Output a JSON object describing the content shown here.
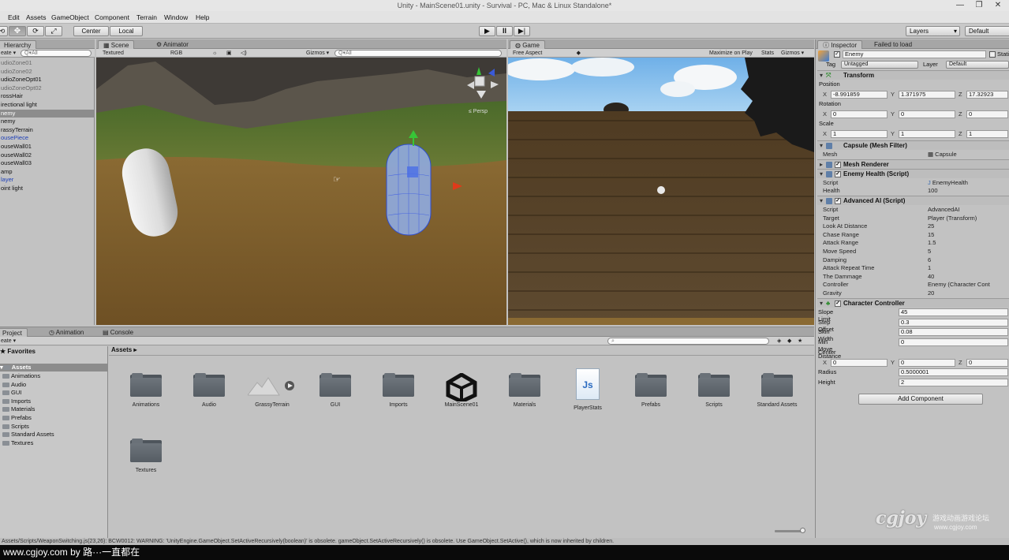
{
  "window": {
    "title": "Unity - MainScene01.unity - Survival - PC, Mac & Linux Standalone*",
    "controls": [
      "—",
      "❐",
      "✕"
    ]
  },
  "menu": [
    "Edit",
    "Assets",
    "GameObject",
    "Component",
    "Terrain",
    "Window",
    "Help"
  ],
  "toolbar": {
    "pivot": "Center",
    "space": "Local",
    "layers": "Layers",
    "layout": "Default"
  },
  "hierarchy": {
    "tab": "Hierarchy",
    "create": "eate ▾",
    "search_placeholder": "Q▾All",
    "items": [
      {
        "label": "udioZone01",
        "style": "grey"
      },
      {
        "label": "udioZone02",
        "style": "grey"
      },
      {
        "label": "udioZoneOpt01",
        "style": "normal"
      },
      {
        "label": "udioZoneOpt02",
        "style": "grey"
      },
      {
        "label": "rossHair",
        "style": "normal"
      },
      {
        "label": "irectional light",
        "style": "normal"
      },
      {
        "label": "nemy",
        "style": "selected"
      },
      {
        "label": "nemy",
        "style": "normal"
      },
      {
        "label": "rassyTerrain",
        "style": "normal"
      },
      {
        "label": "ousePiece",
        "style": "blue"
      },
      {
        "label": "ouseWall01",
        "style": "normal"
      },
      {
        "label": "ouseWall02",
        "style": "normal"
      },
      {
        "label": "ouseWall03",
        "style": "normal"
      },
      {
        "label": "amp",
        "style": "normal"
      },
      {
        "label": "layer",
        "style": "blue"
      },
      {
        "label": "oint light",
        "style": "normal"
      }
    ]
  },
  "scene": {
    "tab_scene": "Scene",
    "tab_animator": "Animator",
    "shading": "Textured",
    "render": "RGB",
    "gizmos": "Gizmos ▾",
    "search_placeholder": "Q▾All",
    "persp": "≤ Persp"
  },
  "game": {
    "tab": "Game",
    "aspect": "Free Aspect",
    "maximize": "Maximize on Play",
    "stats": "Stats",
    "gizmos": "Gizmos ▾"
  },
  "inspector": {
    "tab": "Inspector",
    "tab2": "Failed to load",
    "object_name": "Enemy",
    "static_label": "Static",
    "tag_label": "Tag",
    "tag_value": "Untagged",
    "layer_label": "Layer",
    "layer_value": "Default",
    "transform": {
      "title": "Transform",
      "position_label": "Position",
      "position": {
        "x": "-8.991859",
        "y": "1.371975",
        "z": "17.32923"
      },
      "rotation_label": "Rotation",
      "rotation": {
        "x": "0",
        "y": "0",
        "z": "0"
      },
      "scale_label": "Scale",
      "scale": {
        "x": "1",
        "y": "1",
        "z": "1"
      }
    },
    "mesh_filter": {
      "title": "Capsule (Mesh Filter)",
      "mesh_label": "Mesh",
      "mesh_value": "Capsule"
    },
    "mesh_renderer": {
      "title": "Mesh Renderer"
    },
    "enemy_health": {
      "title": "Enemy Health (Script)",
      "script_label": "Script",
      "script_value": "EnemyHealth",
      "health_label": "Health",
      "health_value": "100"
    },
    "advanced_ai": {
      "title": "Advanced AI (Script)",
      "rows": [
        {
          "label": "Script",
          "value": "AdvancedAI"
        },
        {
          "label": "Target",
          "value": "Player (Transform)"
        },
        {
          "label": "Look At Distance",
          "value": "25"
        },
        {
          "label": "Chase Range",
          "value": "15"
        },
        {
          "label": "Attack Range",
          "value": "1.5"
        },
        {
          "label": "Move Speed",
          "value": "5"
        },
        {
          "label": "Damping",
          "value": "6"
        },
        {
          "label": "Attack Repeat Time",
          "value": "1"
        },
        {
          "label": "The Dammage",
          "value": "40"
        },
        {
          "label": "Controller",
          "value": "Enemy (Character Cont"
        },
        {
          "label": "Gravity",
          "value": "20"
        }
      ]
    },
    "character_controller": {
      "title": "Character Controller",
      "rows": [
        {
          "label": "Slope Limit",
          "value": "45"
        },
        {
          "label": "Step Offset",
          "value": "0.3"
        },
        {
          "label": "Skin Width",
          "value": "0.08"
        },
        {
          "label": "Min Move Distance",
          "value": "0"
        }
      ],
      "center_label": "Center",
      "center": {
        "x": "0",
        "y": "0",
        "z": "0"
      },
      "radius_label": "Radius",
      "radius_value": "0.5000001",
      "height_label": "Height",
      "height_value": "2"
    },
    "add_component": "Add Component"
  },
  "project": {
    "tab_project": "Project",
    "tab_animation": "Animation",
    "tab_console": "Console",
    "create": "eate ▾",
    "favorites": "Favorites",
    "assets_root": "Assets",
    "tree": [
      "Animations",
      "Audio",
      "GUI",
      "Imports",
      "Materials",
      "Prefabs",
      "Scripts",
      "Standard Assets",
      "Textures"
    ],
    "breadcrumb": "Assets ▸",
    "assets": [
      {
        "label": "Animations",
        "kind": "folder"
      },
      {
        "label": "Audio",
        "kind": "folder"
      },
      {
        "label": "GrassyTerrain",
        "kind": "terrain"
      },
      {
        "label": "GUI",
        "kind": "folder"
      },
      {
        "label": "Imports",
        "kind": "folder"
      },
      {
        "label": "MainScene01",
        "kind": "unity"
      },
      {
        "label": "Materials",
        "kind": "folder"
      },
      {
        "label": "PlayerStats",
        "kind": "js"
      },
      {
        "label": "Prefabs",
        "kind": "folder"
      },
      {
        "label": "Scripts",
        "kind": "folder"
      },
      {
        "label": "Standard Assets",
        "kind": "folder"
      },
      {
        "label": "Textures",
        "kind": "folder"
      }
    ]
  },
  "status": {
    "message": "Assets/Scripts/WeaponSwitching.js(23,26): BCW0012: WARNING: 'UnityEngine.GameObject.SetActiveRecursively(boolean)' is obsolete. gameObject.SetActiveRecursively() is obsolete. Use GameObject.SetActive(), which is now inherited by children."
  },
  "watermark": {
    "url_bar": "www.cgjoy.com by 路···一直都在",
    "logo": "cgjoy",
    "cn": "游戏动画游戏论坛",
    "site": "www.cgjoy.com"
  }
}
